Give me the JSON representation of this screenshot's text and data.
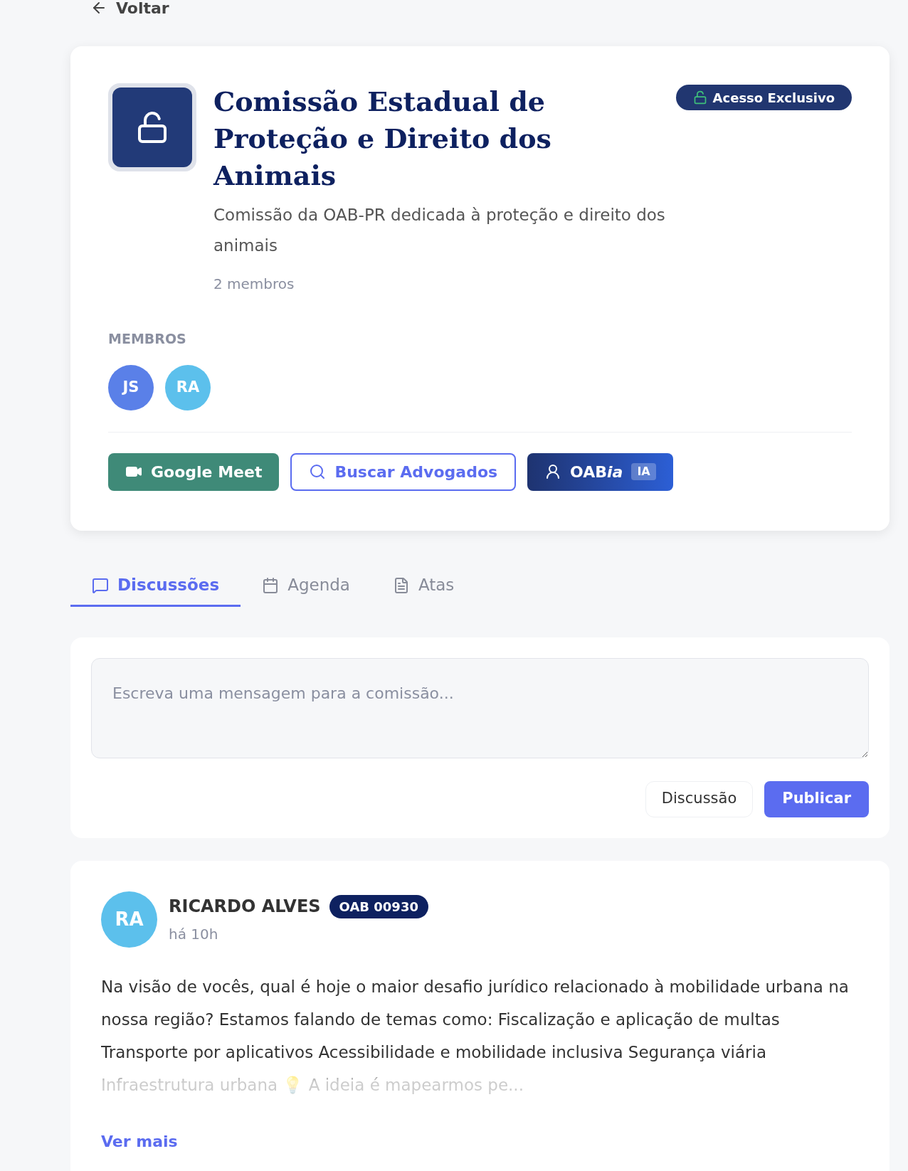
{
  "back_link": "Voltar",
  "committee": {
    "title": "Comissão Estadual de Proteção e Direito dos Animais",
    "badge": "Acesso Exclusivo",
    "description": "Comissão da OAB-PR dedicada à proteção e direito dos animais",
    "member_count": "2 membros"
  },
  "members": {
    "heading": "MEMBROS",
    "avatars": [
      {
        "initials": "JS",
        "color": "#5a80e8"
      },
      {
        "initials": "RA",
        "color": "#5cc0ec"
      }
    ]
  },
  "actions": [
    {
      "kind": "meet",
      "label": "Google Meet"
    },
    {
      "kind": "search",
      "label": "Buscar Advogados"
    },
    {
      "kind": "ai",
      "label": "OAB",
      "label_italic": "ia",
      "tag": "IA"
    }
  ],
  "tabs": [
    {
      "kind": "chat",
      "label": "Discussões",
      "selected": true
    },
    {
      "kind": "calendar",
      "label": "Agenda",
      "selected": false
    },
    {
      "kind": "file",
      "label": "Atas",
      "selected": false
    }
  ],
  "composer": {
    "placeholder": "Escreva uma mensagem para a comissão...",
    "type_button": "Discussão",
    "submit_button": "Publicar"
  },
  "posts": [
    {
      "initials": "RA",
      "color": "#5cc0ec",
      "author": "RICARDO ALVES",
      "badge": "OAB 00930",
      "time": "há 10h",
      "body": "Na visão de vocês, qual é hoje o maior desafio jurídico relacionado à mobilidade urbana na nossa região? Estamos falando de temas como: Fiscalização e aplicação de multas Transporte por aplicativos Acessibilidade e mobilidade inclusiva Segurança viária Infraestrutura urbana 💡 A ideia é mapearmos pe...",
      "more": "Ver mais"
    }
  ]
}
